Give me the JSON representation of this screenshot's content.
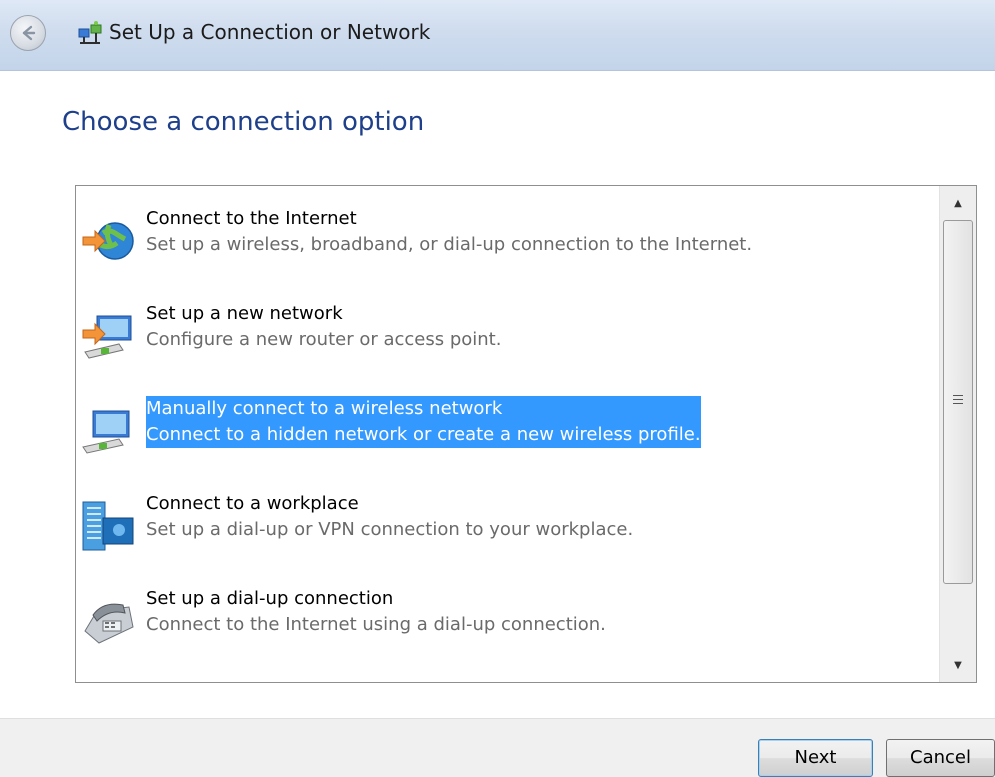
{
  "window": {
    "title": "Set Up a Connection or Network"
  },
  "page": {
    "heading": "Choose a connection option"
  },
  "options": [
    {
      "title": "Connect to the Internet",
      "description": "Set up a wireless, broadband, or dial-up connection to the Internet.",
      "icon": "globe-connect-icon",
      "selected": false
    },
    {
      "title": "Set up a new network",
      "description": "Configure a new router or access point.",
      "icon": "new-network-icon",
      "selected": false
    },
    {
      "title": "Manually connect to a wireless network",
      "description": "Connect to a hidden network or create a new wireless profile.",
      "icon": "wireless-network-icon",
      "selected": true
    },
    {
      "title": "Connect to a workplace",
      "description": "Set up a dial-up or VPN connection to your workplace.",
      "icon": "workplace-icon",
      "selected": false
    },
    {
      "title": "Set up a dial-up connection",
      "description": "Connect to the Internet using a dial-up connection.",
      "icon": "dialup-phone-icon",
      "selected": false
    }
  ],
  "buttons": {
    "next": "Next",
    "cancel": "Cancel"
  },
  "colors": {
    "heading": "#1e3f8a",
    "selection": "#3399ff"
  }
}
